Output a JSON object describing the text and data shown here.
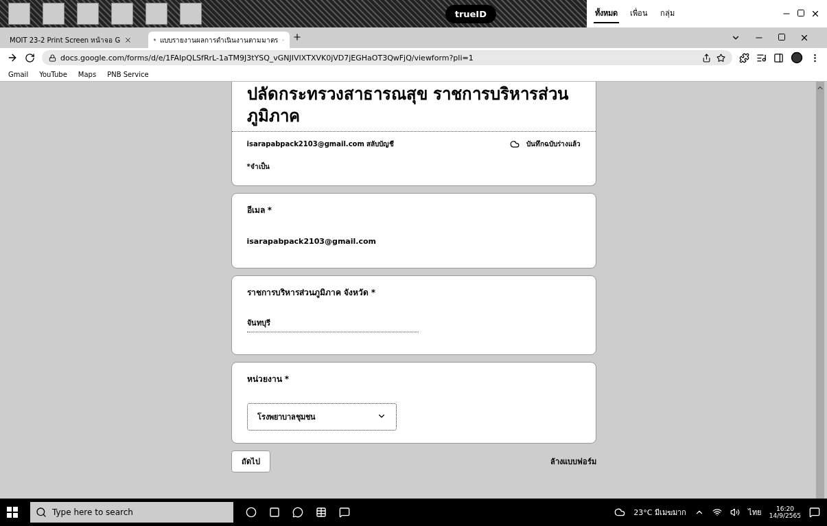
{
  "desktop_strip": {
    "logo": "trueID",
    "chat_window": {
      "tabs": [
        {
          "label": "ทั้งหมด",
          "selected": true
        },
        {
          "label": "เพื่อน",
          "selected": false
        },
        {
          "label": "กลุ่ม",
          "selected": false
        }
      ]
    }
  },
  "browser": {
    "tabs": [
      {
        "title": "MOIT 23-2 Print Screen หน้าจอ G",
        "selected": false
      },
      {
        "title": "แบบรายงานผลการดำเนินงานตามมาตร",
        "selected": true
      }
    ],
    "url": "docs.google.com/forms/d/e/1FAIpQLSfRrL-1aTM9J3tYSQ_vGNJIVIXTXVK0jVD7jEGHaOT3QwFjQ/viewform?pli=1",
    "bookmarks": [
      "Gmail",
      "YouTube",
      "Maps",
      "PNB Service"
    ]
  },
  "form": {
    "title_lines": [
      "ปลัดกระทรวงสาธารณสุข ราชการบริหารส่วน",
      "ภูมิภาค"
    ],
    "account": "isarapabpack2103@gmail.com สลับบัญชี",
    "draft_status": "บันทึกฉบับร่างแล้ว",
    "required_note": "*จำเป็น",
    "questions": [
      {
        "kind": "text",
        "label": "อีเมล *",
        "value": "isarapabpack2103@gmail.com"
      },
      {
        "kind": "line",
        "label": "ราชการบริหารส่วนภูมิภาค จังหวัด *",
        "value": "จันทบุรี"
      },
      {
        "kind": "dropdown",
        "label": "หน่วยงาน *",
        "value": "โรงพยาบาลชุมชน"
      }
    ],
    "next_button": "ถัดไป",
    "clear_link": "ล้างแบบฟอร์ม"
  },
  "taskbar": {
    "search_placeholder": "Type here to search",
    "weather": "23°C มีเมฆมาก",
    "language": "ไทย",
    "time": "16:20",
    "date": "14/9/2565"
  }
}
